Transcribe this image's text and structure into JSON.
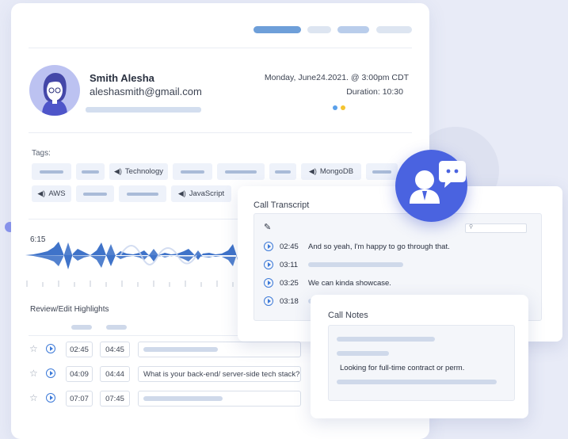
{
  "colors": {
    "accent": "#4f7fe0",
    "bubble": "#4a63e0",
    "dot_blue": "#5aa0ea",
    "dot_yellow": "#f4c430"
  },
  "profile": {
    "name": "Smith Alesha",
    "email": "aleshasmith@gmail.com",
    "date": "Monday, June24.2021. @ 3:00pm CDT",
    "duration": "Duration: 10:30"
  },
  "tags": {
    "label": "Tags:",
    "technology": "Technology",
    "mongodb": "MongoDB",
    "aws": "AWS",
    "javascript": "JavaScript"
  },
  "waveform": {
    "time": "6:15"
  },
  "review": {
    "label": "Review/Edit Highlights",
    "rows": [
      {
        "start": "02:45",
        "end": "04:45",
        "text": ""
      },
      {
        "start": "04:09",
        "end": "04:44",
        "text": "What is your back-end/ server-side tech stack?"
      },
      {
        "start": "07:07",
        "end": "07:45",
        "text": ""
      }
    ]
  },
  "transcript": {
    "title": "Call Transcript",
    "search_icon": "search-icon",
    "rows": [
      {
        "time": "02:45",
        "text": "And so yeah, I'm happy to go through that."
      },
      {
        "time": "03:11",
        "text": ""
      },
      {
        "time": "03:25",
        "text": "We can kinda showcase."
      },
      {
        "time": "03:18",
        "text": ""
      }
    ]
  },
  "notes": {
    "title": "Call Notes",
    "text": "Looking for full-time contract or perm."
  }
}
